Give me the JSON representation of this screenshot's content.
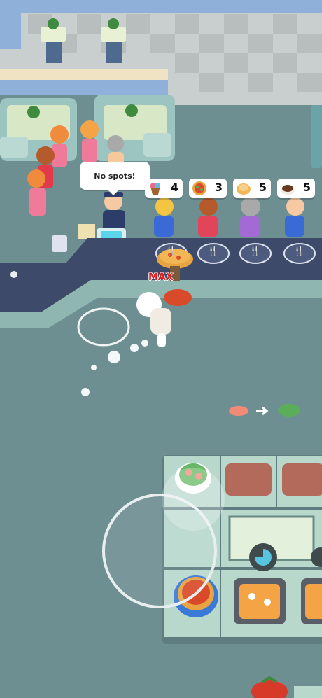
{
  "speech_bubble": {
    "text": "No spots!"
  },
  "orders": [
    {
      "icon": "ice-cream-cup-icon",
      "count": "4"
    },
    {
      "icon": "pizza-icon",
      "count": "3"
    },
    {
      "icon": "pancake-icon",
      "count": "5"
    },
    {
      "icon": "coffee-cup-icon",
      "count": "5"
    }
  ],
  "carry_label": "MAX",
  "colors": {
    "floor": "#6e8f92",
    "counter": "#3d4a6a",
    "counter_trim": "#8fb6b0",
    "bubble": "#ffffff",
    "max_label": "#d81e1e"
  }
}
